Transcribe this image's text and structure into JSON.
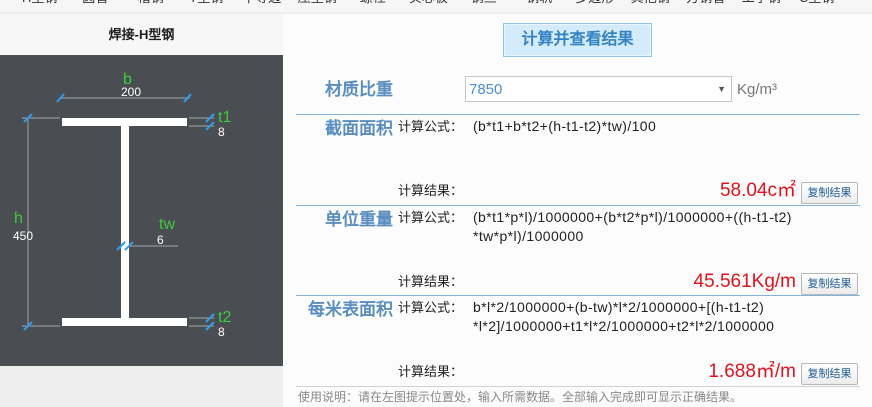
{
  "top_tabs": [
    "H型钢",
    "圆管",
    "槽钢",
    "T型钢",
    "不等边",
    "压型钢",
    "螺栓",
    "实心板",
    "钢丝",
    "钢轨",
    "多边形",
    "其他钢",
    "方钢管",
    "工字钢",
    "C型钢"
  ],
  "diagram": {
    "title": "焊接-H型钢",
    "dims": {
      "b": {
        "symbol": "b",
        "value": "200"
      },
      "t1": {
        "symbol": "t1",
        "value": "8"
      },
      "h": {
        "symbol": "h",
        "value": "450"
      },
      "tw": {
        "symbol": "tw",
        "value": "6"
      },
      "t2": {
        "symbol": "t2",
        "value": "8"
      }
    }
  },
  "calc_button": {
    "label": "计算并查看结果"
  },
  "density": {
    "label": "材质比重",
    "value": "7850",
    "unit": "Kg/m³"
  },
  "sections": [
    {
      "label": "截面面积",
      "formula_label": "计算公式：",
      "formula_lines": [
        "(b*t1+b*t2+(h-t1-t2)*tw)/100"
      ],
      "result_label": "计算结果：",
      "result": "58.04c㎡",
      "copy_label": "复制结果"
    },
    {
      "label": "单位重量",
      "formula_label": "计算公式：",
      "formula_lines": [
        "(b*t1*p*l)/1000000+(b*t2*p*l)/1000000+((h-t1-t2)",
        "*tw*p*l)/1000000"
      ],
      "result_label": "计算结果：",
      "result": "45.561Kg/m",
      "copy_label": "复制结果"
    },
    {
      "label": "每米表面积",
      "formula_label": "计算公式：",
      "formula_lines": [
        "b*l*2/1000000+(b-tw)*l*2/1000000+[(h-t1-t2)",
        "*l*2]/1000000+t1*l*2/1000000+t2*l*2/1000000"
      ],
      "result_label": "计算结果：",
      "result": "1.688㎡/m",
      "copy_label": "复制结果"
    }
  ],
  "usage_note": "使用说明：请在左图提示位置处，输入所需数据。全部输入完成即可显示正确结果。",
  "icons": {
    "density_dropdown": "caret-down-icon"
  },
  "colors": {
    "section_label_blue": "#5a8ec0",
    "result_red": "#e3121c",
    "dimension_symbol_green": "#3ccc3c",
    "dimension_tick_blue": "#2e9df0",
    "diagram_background": "#4a4d52",
    "calc_button_background": "#d3ebfa"
  }
}
